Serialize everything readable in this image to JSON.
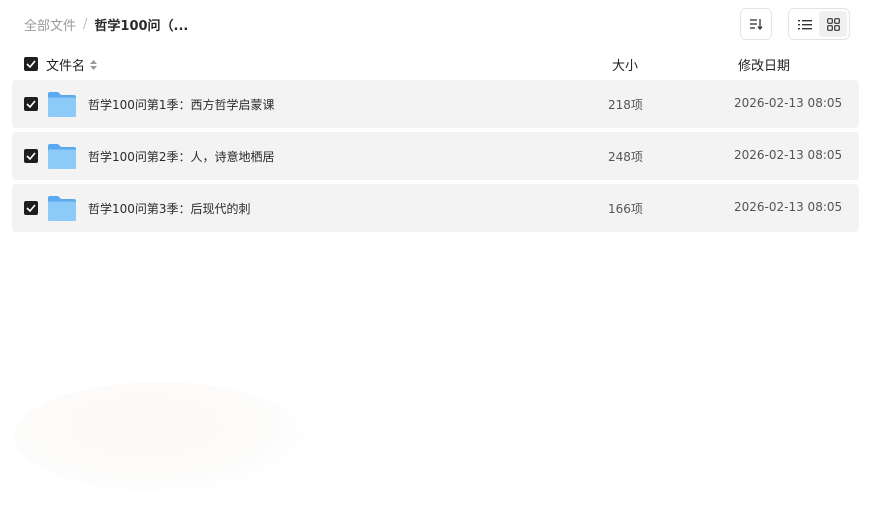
{
  "breadcrumb": {
    "root": "全部文件",
    "separator": "/",
    "current": "哲学100问（..."
  },
  "toolbar": {
    "sort_icon": "sort-icon",
    "list_view_icon": "list-view-icon",
    "grid_view_icon": "grid-view-icon",
    "active_view": "grid"
  },
  "header": {
    "name": "文件名",
    "size": "大小",
    "date": "修改日期"
  },
  "files": [
    {
      "name": "哲学100问第1季：西方哲学启蒙课",
      "size": "218项",
      "date": "2026-02-13 08:05",
      "checked": true
    },
    {
      "name": "哲学100问第2季：人，诗意地栖居",
      "size": "248项",
      "date": "2026-02-13 08:05",
      "checked": true
    },
    {
      "name": "哲学100问第3季：后现代的刺",
      "size": "166项",
      "date": "2026-02-13 08:05",
      "checked": true
    }
  ],
  "colors": {
    "checkbox": "#1e1e1e",
    "row_bg": "#f3f3f3",
    "folder": "#6cb7f3"
  }
}
